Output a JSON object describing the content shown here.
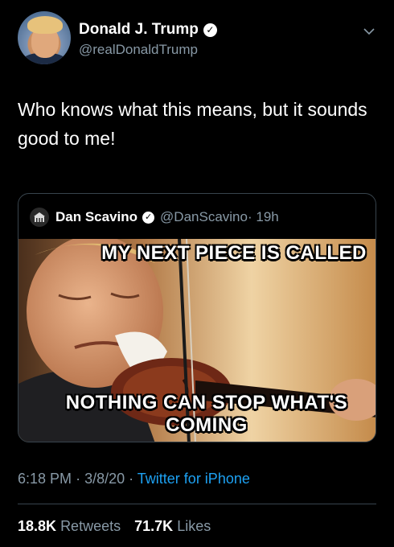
{
  "author": {
    "name": "Donald J. Trump",
    "handle": "@realDonaldTrump",
    "verified": true
  },
  "tweet": {
    "text": "Who knows what this means, but it sounds good to me!"
  },
  "quoted_tweet": {
    "name": "Dan Scavino",
    "handle": "@DanScavino",
    "time": "19h",
    "verified": true,
    "meme_top_text": "MY NEXT PIECE IS CALLED",
    "meme_bottom_text": "NOTHING CAN STOP WHAT'S COMING"
  },
  "meta": {
    "time": "6:18 PM",
    "date": "3/8/20",
    "source": "Twitter for iPhone"
  },
  "stats": {
    "retweets": "18.8K",
    "retweets_label": "Retweets",
    "likes": "71.7K",
    "likes_label": "Likes"
  },
  "colors": {
    "background": "#000000",
    "secondary_text": "#8899a6",
    "link": "#1da1f2",
    "border": "#38444d"
  },
  "icons": [
    "verified-badge-icon",
    "chevron-down-icon"
  ]
}
